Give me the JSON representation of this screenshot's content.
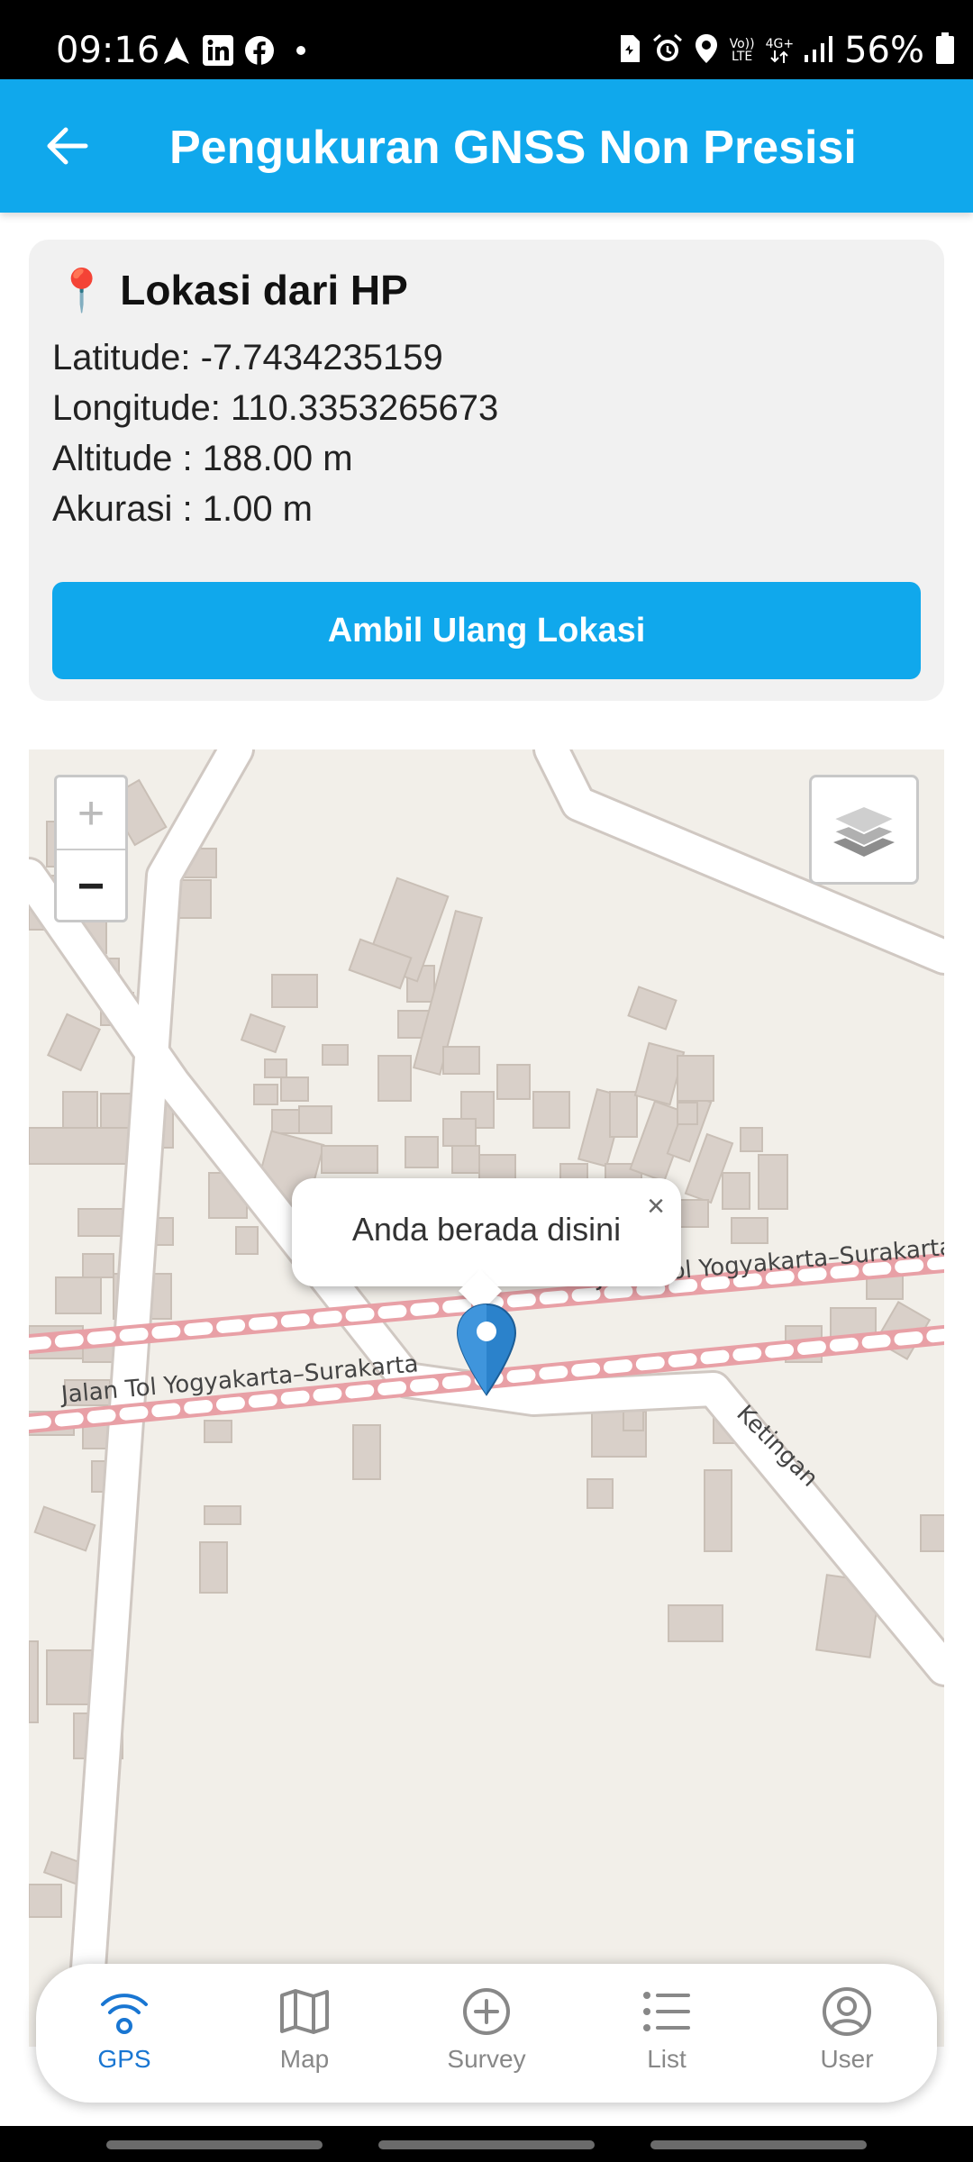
{
  "status_bar": {
    "time": "09:16",
    "volte_top": "Vo))",
    "volte_bottom": "LTE",
    "network": "4G+",
    "battery_percent": "56%",
    "left_icons": [
      "navigation-icon",
      "linkedin-icon",
      "facebook-icon",
      "dot-icon"
    ],
    "right_icons": [
      "sim-icon",
      "alarm-icon",
      "location-icon",
      "volte-icon",
      "4g-icon",
      "signal-icon",
      "battery-icon"
    ]
  },
  "app_bar": {
    "title": "Pengukuran GNSS Non Presisi",
    "color": "#10a8ec"
  },
  "location_card": {
    "heading_icon": "📍",
    "heading": "Lokasi dari HP",
    "latitude": "Latitude: -7.7434235159",
    "longitude": "Longitude: 110.3353265673",
    "altitude": "Altitude : 188.00 m",
    "accuracy": "Akurasi : 1.00 m",
    "button_label": "Ambil Ulang Lokasi"
  },
  "map": {
    "zoom_in": "+",
    "zoom_out": "−",
    "road_label_1": "Jalan Tol Yogyakarta–Surakarta",
    "road_label_2": "Jalan Tol Yogyakarta–Surakarta",
    "road_label_3": "Ketingan",
    "popup_text": "Anda berada disini",
    "popup_close": "×"
  },
  "bottom_nav": {
    "active_color": "#1976d2",
    "items": [
      {
        "label": "GPS",
        "icon": "gps-icon",
        "active": true
      },
      {
        "label": "Map",
        "icon": "map-icon",
        "active": false
      },
      {
        "label": "Survey",
        "icon": "plus-circle-icon",
        "active": false
      },
      {
        "label": "List",
        "icon": "list-icon",
        "active": false
      },
      {
        "label": "User",
        "icon": "user-icon",
        "active": false
      }
    ]
  }
}
